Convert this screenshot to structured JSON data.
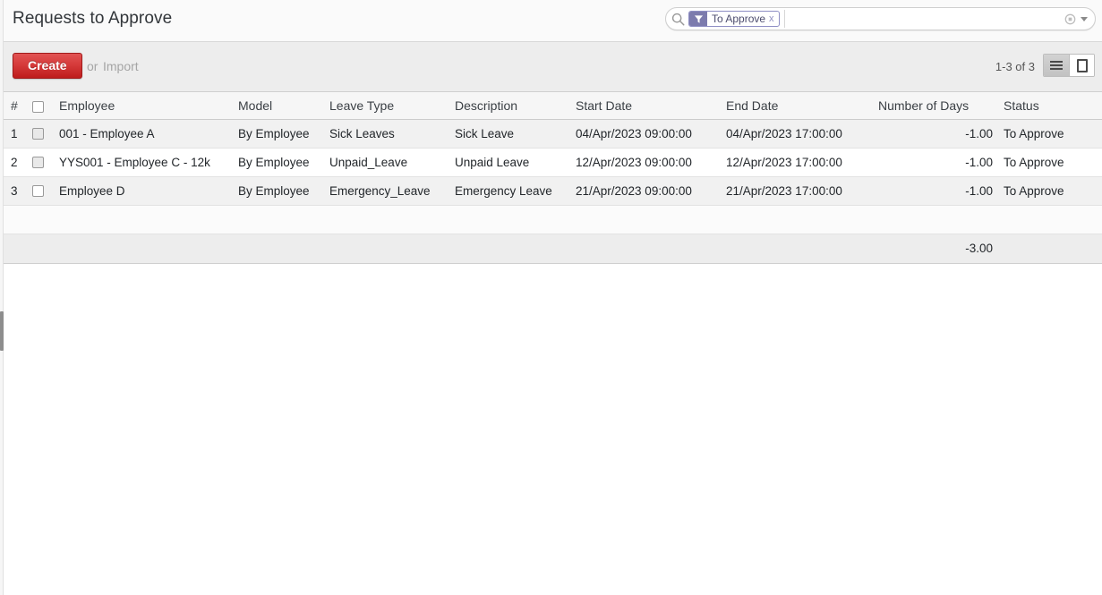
{
  "header": {
    "title": "Requests to Approve"
  },
  "search": {
    "icon": "search-icon",
    "facet": {
      "icon": "filter-funnel-icon",
      "label": "To Approve",
      "remove_label": "x"
    },
    "value": "",
    "placeholder": "",
    "clear_icon": "clear-icon",
    "dropdown_icon": "chevron-down-icon"
  },
  "toolbar": {
    "create_label": "Create",
    "or_label": "or",
    "import_label": "Import",
    "pager_label": "1-3 of 3",
    "views": [
      {
        "name": "list",
        "icon": "list-view-icon",
        "active": true
      },
      {
        "name": "form",
        "icon": "form-view-icon",
        "active": false
      }
    ]
  },
  "table": {
    "columns": [
      {
        "key": "num",
        "label": "#"
      },
      {
        "key": "check",
        "label": ""
      },
      {
        "key": "employee",
        "label": "Employee"
      },
      {
        "key": "model",
        "label": "Model"
      },
      {
        "key": "leave_type",
        "label": "Leave Type"
      },
      {
        "key": "description",
        "label": "Description"
      },
      {
        "key": "start_date",
        "label": "Start Date"
      },
      {
        "key": "end_date",
        "label": "End Date"
      },
      {
        "key": "number_of_days",
        "label": "Number of Days"
      },
      {
        "key": "status",
        "label": "Status"
      }
    ],
    "rows": [
      {
        "num": "1",
        "employee": "001 - Employee A",
        "model": "By Employee",
        "leave_type": "Sick Leaves",
        "description": "Sick Leave",
        "start_date": "04/Apr/2023 09:00:00",
        "end_date": "04/Apr/2023 17:00:00",
        "number_of_days": "-1.00",
        "status": "To Approve"
      },
      {
        "num": "2",
        "employee": "YYS001 - Employee C - 12k",
        "model": "By Employee",
        "leave_type": "Unpaid_Leave",
        "description": "Unpaid Leave",
        "start_date": "12/Apr/2023 09:00:00",
        "end_date": "12/Apr/2023 17:00:00",
        "number_of_days": "-1.00",
        "status": "To Approve"
      },
      {
        "num": "3",
        "employee": "Employee D",
        "model": "By Employee",
        "leave_type": "Emergency_Leave",
        "description": "Emergency Leave",
        "start_date": "21/Apr/2023 09:00:00",
        "end_date": "21/Apr/2023 17:00:00",
        "number_of_days": "-1.00",
        "status": "To Approve"
      }
    ],
    "footer": {
      "number_of_days_total": "-3.00"
    }
  },
  "colors": {
    "accent_red": "#be1c1c",
    "facet_purple": "#7c7bad",
    "header_bg": "#f6f6f6",
    "band_bg": "#ededed"
  }
}
